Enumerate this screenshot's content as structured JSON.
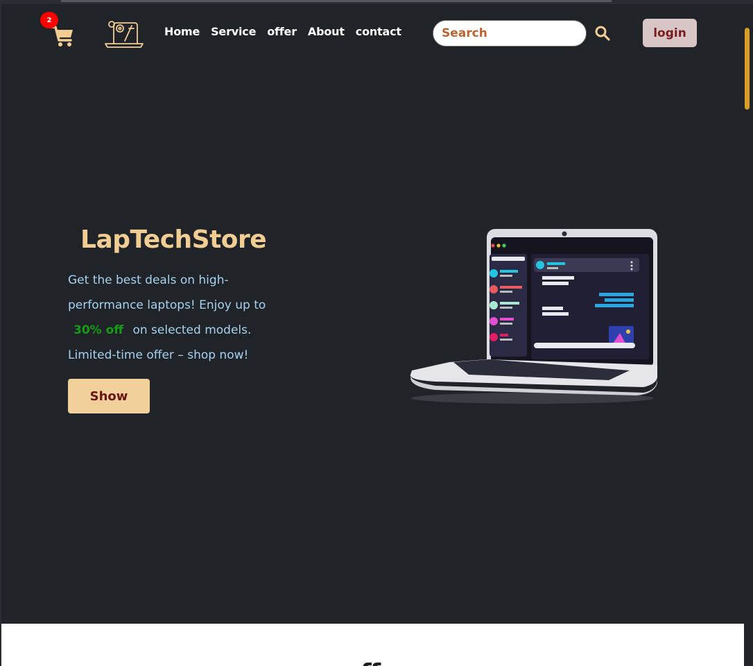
{
  "header": {
    "cart_count": "2",
    "nav": [
      "Home",
      "Service",
      "offer",
      "About",
      "contact"
    ],
    "search_placeholder": "Search",
    "login_label": "login"
  },
  "hero": {
    "title": "LapTechStore",
    "text_before": "Get the best deals on high-performance laptops! Enjoy up to",
    "discount": "30% off",
    "text_after": "on selected models. Limited-time offer – shop now!",
    "button_label": "Show"
  },
  "next_section": {
    "heading_peek": "ff"
  },
  "icons": {
    "cart": "cart-icon",
    "logo": "laptop-gear-logo-icon",
    "search": "search-icon"
  },
  "colors": {
    "background": "#202328",
    "accent": "#f2cd93",
    "text_blue": "#a6d2f0",
    "discount": "#159b15",
    "badge": "#ff0000",
    "scrollbar": "#d99c27"
  }
}
